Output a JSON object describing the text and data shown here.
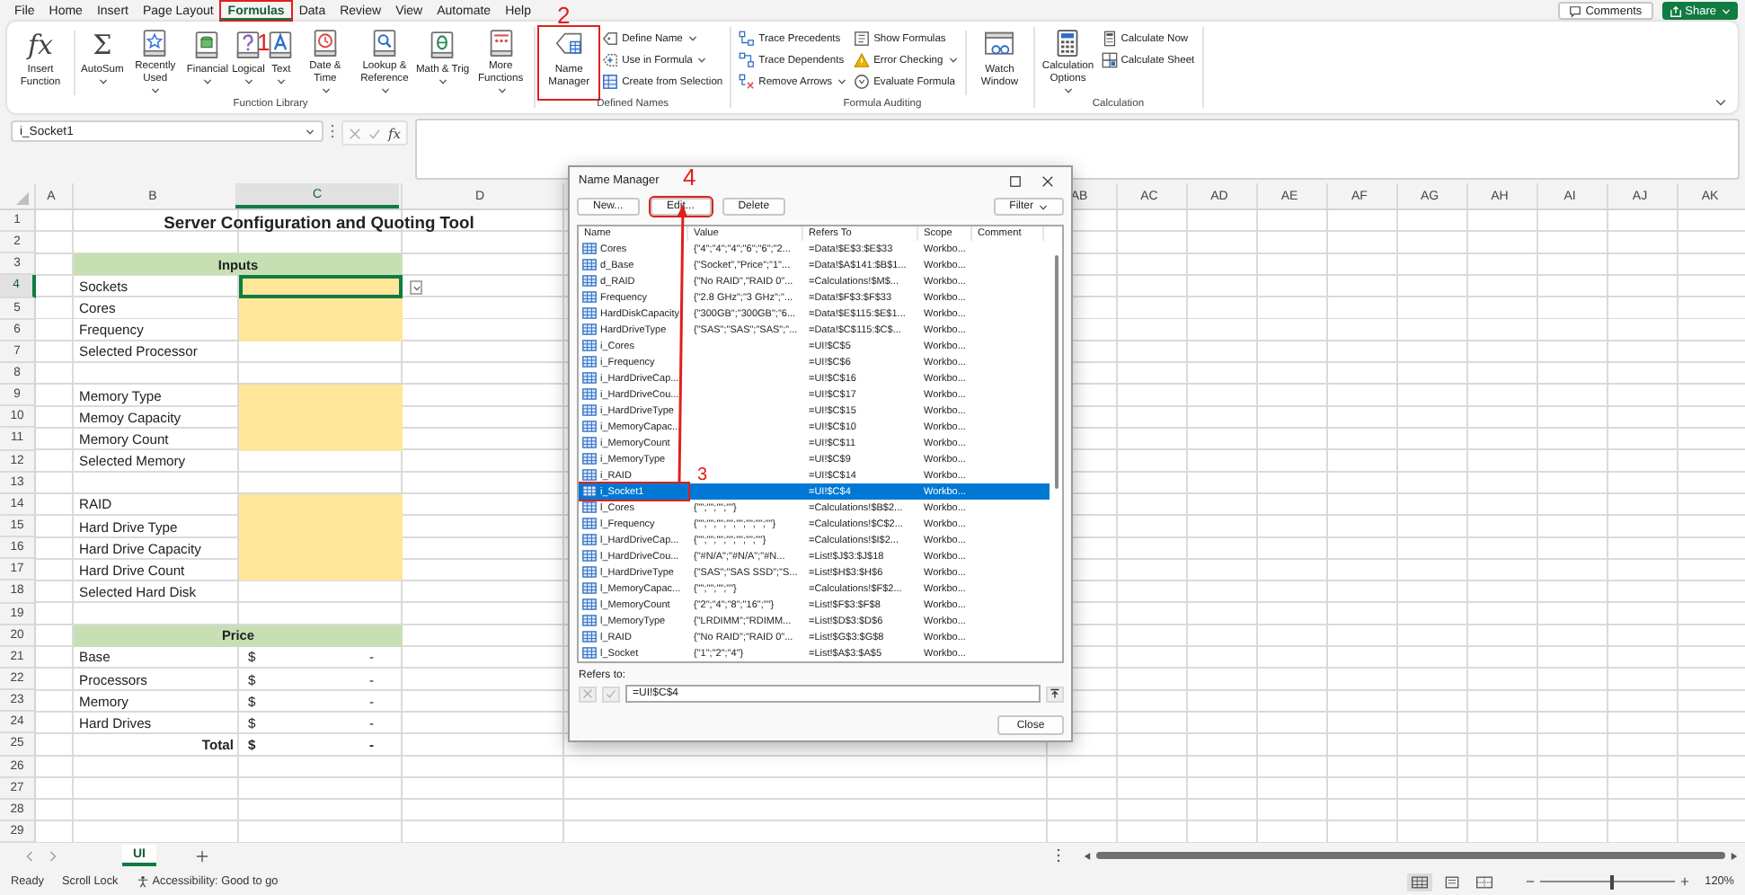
{
  "menu": {
    "tabs": [
      {
        "label": "File",
        "selected": false,
        "annotated": false
      },
      {
        "label": "Home",
        "selected": false,
        "annotated": false
      },
      {
        "label": "Insert",
        "selected": false,
        "annotated": false
      },
      {
        "label": "Page Layout",
        "selected": false,
        "annotated": false
      },
      {
        "label": "Formulas",
        "selected": true,
        "annotated": true
      },
      {
        "label": "Data",
        "selected": false,
        "annotated": false
      },
      {
        "label": "Review",
        "selected": false,
        "annotated": false
      },
      {
        "label": "View",
        "selected": false,
        "annotated": false
      },
      {
        "label": "Automate",
        "selected": false,
        "annotated": false
      },
      {
        "label": "Help",
        "selected": false,
        "annotated": false
      }
    ],
    "comments": "Comments",
    "share": "Share"
  },
  "ribbon": {
    "groups": [
      {
        "label": "Function Library",
        "items": [
          {
            "kind": "big",
            "label": "Insert Function",
            "glyph": "fx",
            "dropdown": false,
            "annotated": false
          },
          {
            "kind": "separator"
          },
          {
            "kind": "big",
            "label": "AutoSum",
            "glyph": "Σ",
            "dropdown": true,
            "annotated": false
          },
          {
            "kind": "big",
            "label": "Recently Used",
            "dropdown": true,
            "annotated": false
          },
          {
            "kind": "big",
            "label": "Financial",
            "dropdown": true,
            "annotated": false
          },
          {
            "kind": "big",
            "label": "Logical",
            "dropdown": true,
            "annotated": false
          },
          {
            "kind": "big",
            "label": "Text",
            "dropdown": true,
            "annotated": false
          },
          {
            "kind": "big",
            "label": "Date & Time",
            "dropdown": true,
            "annotated": false
          },
          {
            "kind": "big",
            "label": "Lookup & Reference",
            "dropdown": true,
            "annotated": false
          },
          {
            "kind": "big",
            "label": "Math & Trig",
            "dropdown": true,
            "annotated": false
          },
          {
            "kind": "big",
            "label": "More Functions",
            "dropdown": true,
            "annotated": false
          }
        ]
      },
      {
        "label": "Defined Names",
        "items": [
          {
            "kind": "big",
            "label": "Name Manager",
            "dropdown": false,
            "annotated": true
          },
          {
            "kind": "stack",
            "buttons": [
              {
                "label": "Define Name",
                "dropdown": true
              },
              {
                "label": "Use in Formula",
                "dropdown": true
              },
              {
                "label": "Create from Selection",
                "dropdown": false
              }
            ]
          }
        ]
      },
      {
        "label": "Formula Auditing",
        "items": [
          {
            "kind": "stack",
            "buttons": [
              {
                "label": "Trace Precedents",
                "dropdown": false
              },
              {
                "label": "Trace Dependents",
                "dropdown": false
              },
              {
                "label": "Remove Arrows",
                "dropdown": true
              }
            ]
          },
          {
            "kind": "stack",
            "buttons": [
              {
                "label": "Show Formulas",
                "dropdown": false
              },
              {
                "label": "Error Checking",
                "dropdown": true
              },
              {
                "label": "Evaluate Formula",
                "dropdown": false
              }
            ]
          },
          {
            "kind": "separator"
          },
          {
            "kind": "big",
            "label": "Watch Window",
            "dropdown": false,
            "annotated": false
          }
        ]
      },
      {
        "label": "Calculation",
        "items": [
          {
            "kind": "big",
            "label": "Calculation Options",
            "dropdown": true,
            "annotated": false
          },
          {
            "kind": "stack",
            "buttons": [
              {
                "label": "Calculate Now",
                "dropdown": false
              },
              {
                "label": "Calculate Sheet",
                "dropdown": false
              }
            ]
          }
        ]
      }
    ]
  },
  "formula_bar": {
    "name_box": "i_Socket1",
    "fx": "fx"
  },
  "sheet": {
    "columns": [
      {
        "label": "A",
        "selected": false
      },
      {
        "label": "B",
        "selected": false
      },
      {
        "label": "C",
        "selected": true
      },
      {
        "label": "D",
        "selected": false
      },
      {
        "label": "AB",
        "selected": false
      },
      {
        "label": "AC",
        "selected": false
      },
      {
        "label": "AD",
        "selected": false
      },
      {
        "label": "AE",
        "selected": false
      },
      {
        "label": "AF",
        "selected": false
      },
      {
        "label": "AG",
        "selected": false
      },
      {
        "label": "AH",
        "selected": false
      },
      {
        "label": "AI",
        "selected": false
      },
      {
        "label": "AJ",
        "selected": false
      },
      {
        "label": "AK",
        "selected": false
      }
    ],
    "rows": [
      {
        "number": "1",
        "kind": "title",
        "label": "Server Configuration and Quoting Tool",
        "selected": false
      },
      {
        "number": "2",
        "kind": "blank",
        "selected": false
      },
      {
        "number": "3",
        "kind": "header",
        "label": "Inputs",
        "selected": false
      },
      {
        "number": "4",
        "kind": "input",
        "label": "Sockets",
        "active": true,
        "selected": true
      },
      {
        "number": "5",
        "kind": "input",
        "label": "Cores",
        "active": false,
        "selected": false
      },
      {
        "number": "6",
        "kind": "input",
        "label": "Frequency",
        "active": false,
        "selected": false
      },
      {
        "number": "7",
        "kind": "label",
        "label": "Selected Processor",
        "selected": false
      },
      {
        "number": "8",
        "kind": "blank",
        "selected": false
      },
      {
        "number": "9",
        "kind": "input",
        "label": "Memory Type",
        "active": false,
        "selected": false
      },
      {
        "number": "10",
        "kind": "input",
        "label": "Memoy Capacity",
        "active": false,
        "selected": false
      },
      {
        "number": "11",
        "kind": "input",
        "label": "Memory Count",
        "active": false,
        "selected": false
      },
      {
        "number": "12",
        "kind": "label",
        "label": "Selected Memory",
        "selected": false
      },
      {
        "number": "13",
        "kind": "blank",
        "selected": false
      },
      {
        "number": "14",
        "kind": "input",
        "label": "RAID",
        "active": false,
        "selected": false
      },
      {
        "number": "15",
        "kind": "input",
        "label": "Hard Drive Type",
        "active": false,
        "selected": false
      },
      {
        "number": "16",
        "kind": "input",
        "label": "Hard Drive Capacity",
        "active": false,
        "selected": false
      },
      {
        "number": "17",
        "kind": "input",
        "label": "Hard Drive Count",
        "active": false,
        "selected": false
      },
      {
        "number": "18",
        "kind": "label",
        "label": "Selected Hard Disk",
        "selected": false
      },
      {
        "number": "19",
        "kind": "blank",
        "selected": false
      },
      {
        "number": "20",
        "kind": "header",
        "label": "Price",
        "selected": false
      },
      {
        "number": "21",
        "kind": "price",
        "label": "Base",
        "currency": "$",
        "value": "-",
        "selected": false
      },
      {
        "number": "22",
        "kind": "price",
        "label": "Processors",
        "currency": "$",
        "value": "-",
        "selected": false
      },
      {
        "number": "23",
        "kind": "price",
        "label": "Memory",
        "currency": "$",
        "value": "-",
        "selected": false
      },
      {
        "number": "24",
        "kind": "price",
        "label": "Hard Drives",
        "currency": "$",
        "value": "-",
        "selected": false
      },
      {
        "number": "25",
        "kind": "total",
        "label": "Total",
        "currency": "$",
        "value": "-",
        "selected": false
      },
      {
        "number": "26",
        "kind": "blank",
        "selected": false
      },
      {
        "number": "27",
        "kind": "blank",
        "selected": false
      },
      {
        "number": "28",
        "kind": "blank",
        "selected": false
      },
      {
        "number": "29",
        "kind": "blank",
        "selected": false
      }
    ]
  },
  "sheet_tabs": {
    "tabs": [
      {
        "label": "UI",
        "selected": true
      }
    ]
  },
  "status_bar": {
    "ready": "Ready",
    "scroll_lock": "Scroll Lock",
    "accessibility": "Accessibility: Good to go",
    "views": [
      {
        "selected": true
      },
      {
        "selected": false
      },
      {
        "selected": false
      }
    ],
    "zoom": {
      "level": 0.53,
      "reading": "120%"
    }
  },
  "dialog": {
    "title": "Name Manager",
    "buttons": [
      {
        "label": "New...",
        "dropdown": false,
        "annotated": false
      },
      {
        "label": "Edit...",
        "dropdown": false,
        "annotated": true
      },
      {
        "label": "Delete",
        "dropdown": false,
        "annotated": false
      },
      {
        "label": "Filter",
        "dropdown": true,
        "annotated": false
      }
    ],
    "columns": [
      "Name",
      "Value",
      "Refers To",
      "Scope",
      "Comment"
    ],
    "names": [
      {
        "name": "Cores",
        "value": "{\"4\";\"4\";\"4\";\"6\";\"6\";\"2...",
        "refers_to": "=Data!$E$3:$E$33",
        "scope": "Workbo...",
        "selected": false,
        "annotated": false
      },
      {
        "name": "d_Base",
        "value": "{\"Socket\",\"Price\";\"1\"...",
        "refers_to": "=Data!$A$141:$B$1...",
        "scope": "Workbo...",
        "selected": false,
        "annotated": false
      },
      {
        "name": "d_RAID",
        "value": "{\"No RAID\",\"RAID 0\"...",
        "refers_to": "=Calculations!$M$...",
        "scope": "Workbo...",
        "selected": false,
        "annotated": false
      },
      {
        "name": "Frequency",
        "value": "{\"2.8 GHz\";\"3 GHz\";\"...",
        "refers_to": "=Data!$F$3:$F$33",
        "scope": "Workbo...",
        "selected": false,
        "annotated": false
      },
      {
        "name": "HardDiskCapacity",
        "value": "{\"300GB\";\"300GB\";\"6...",
        "refers_to": "=Data!$E$115:$E$1...",
        "scope": "Workbo...",
        "selected": false,
        "annotated": false
      },
      {
        "name": "HardDriveType",
        "value": "{\"SAS\";\"SAS\";\"SAS\";\"...",
        "refers_to": "=Data!$C$115:$C$...",
        "scope": "Workbo...",
        "selected": false,
        "annotated": false
      },
      {
        "name": "i_Cores",
        "refers_to": "=UI!$C$5",
        "scope": "Workbo...",
        "selected": false,
        "annotated": false
      },
      {
        "name": "i_Frequency",
        "refers_to": "=UI!$C$6",
        "scope": "Workbo...",
        "selected": false,
        "annotated": false
      },
      {
        "name": "i_HardDriveCap...",
        "refers_to": "=UI!$C$16",
        "scope": "Workbo...",
        "selected": false,
        "annotated": false
      },
      {
        "name": "i_HardDriveCou...",
        "refers_to": "=UI!$C$17",
        "scope": "Workbo...",
        "selected": false,
        "annotated": false
      },
      {
        "name": "i_HardDriveType",
        "refers_to": "=UI!$C$15",
        "scope": "Workbo...",
        "selected": false,
        "annotated": false
      },
      {
        "name": "i_MemoryCapac...",
        "refers_to": "=UI!$C$10",
        "scope": "Workbo...",
        "selected": false,
        "annotated": false
      },
      {
        "name": "i_MemoryCount",
        "refers_to": "=UI!$C$11",
        "scope": "Workbo...",
        "selected": false,
        "annotated": false
      },
      {
        "name": "i_MemoryType",
        "refers_to": "=UI!$C$9",
        "scope": "Workbo...",
        "selected": false,
        "annotated": false
      },
      {
        "name": "i_RAID",
        "refers_to": "=UI!$C$14",
        "scope": "Workbo...",
        "selected": false,
        "annotated": false
      },
      {
        "name": "i_Socket1",
        "refers_to": "=UI!$C$4",
        "scope": "Workbo...",
        "selected": true,
        "annotated": true
      },
      {
        "name": "l_Cores",
        "value": "{\"\";\"\";\"\";\"\"}",
        "refers_to": "=Calculations!$B$2...",
        "scope": "Workbo...",
        "selected": false,
        "annotated": false
      },
      {
        "name": "l_Frequency",
        "value": "{\"\";\"\";\"\";\"\";\"\";\"\";\"\";\"\"}",
        "refers_to": "=Calculations!$C$2...",
        "scope": "Workbo...",
        "selected": false,
        "annotated": false
      },
      {
        "name": "l_HardDriveCap...",
        "value": "{\"\";\"\";\"\";\"\";\"\";\"\";\"\"}",
        "refers_to": "=Calculations!$I$2...",
        "scope": "Workbo...",
        "selected": false,
        "annotated": false
      },
      {
        "name": "l_HardDriveCou...",
        "value": "{\"#N/A\";\"#N/A\";\"#N...",
        "refers_to": "=List!$J$3:$J$18",
        "scope": "Workbo...",
        "selected": false,
        "annotated": false
      },
      {
        "name": "l_HardDriveType",
        "value": "{\"SAS\";\"SAS SSD\";\"S...",
        "refers_to": "=List!$H$3:$H$6",
        "scope": "Workbo...",
        "selected": false,
        "annotated": false
      },
      {
        "name": "l_MemoryCapac...",
        "value": "{\"\";\"\";\"\";\"\"}",
        "refers_to": "=Calculations!$F$2...",
        "scope": "Workbo...",
        "selected": false,
        "annotated": false
      },
      {
        "name": "l_MemoryCount",
        "value": "{\"2\";\"4\";\"8\";\"16\";\"\"}",
        "refers_to": "=List!$F$3:$F$8",
        "scope": "Workbo...",
        "selected": false,
        "annotated": false
      },
      {
        "name": "l_MemoryType",
        "value": "{\"LRDIMM\";\"RDIMM...",
        "refers_to": "=List!$D$3:$D$6",
        "scope": "Workbo...",
        "selected": false,
        "annotated": false
      },
      {
        "name": "l_RAID",
        "value": "{\"No RAID\";\"RAID 0\"...",
        "refers_to": "=List!$G$3:$G$8",
        "scope": "Workbo...",
        "selected": false,
        "annotated": false
      },
      {
        "name": "l_Socket",
        "value": "{\"1\";\"2\";\"4\"}",
        "refers_to": "=List!$A$3:$A$5",
        "scope": "Workbo...",
        "selected": false,
        "annotated": false
      }
    ],
    "refers_label": "Refers to:",
    "refers_value": "=UI!$C$4",
    "close": "Close"
  },
  "annotations": [
    {
      "label": "1"
    },
    {
      "label": "2"
    },
    {
      "label": "3"
    },
    {
      "label": "4"
    }
  ]
}
